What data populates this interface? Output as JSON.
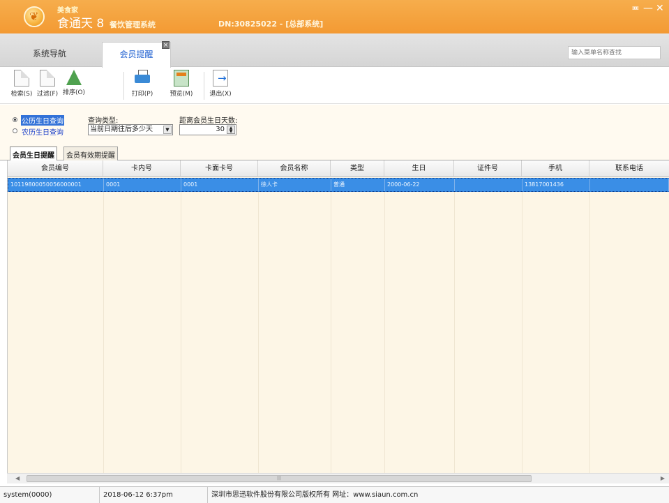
{
  "titlebar": {
    "brand_small": "美食家",
    "brand_main": "食通天 8",
    "brand_sub": "餐饮管理系统",
    "dn": "DN:30825022 - [总部系统]",
    "pin": "≖",
    "minimize": "—",
    "close": "✕"
  },
  "tabs": {
    "nav": "系统导航",
    "active": "会员提醒",
    "close_glyph": "×",
    "search_placeholder": "输入菜单名称查找"
  },
  "toolbar": {
    "items": [
      {
        "label": "检索(S)",
        "icon": "search-doc-icon"
      },
      {
        "label": "过滤(F)",
        "icon": "filter-doc-icon"
      },
      {
        "label": "排序(O)",
        "icon": "sort-icon"
      },
      {
        "label": "打印(P)",
        "icon": "printer-icon"
      },
      {
        "label": "预览(M)",
        "icon": "preview-icon"
      },
      {
        "label": "退出(X)",
        "icon": "exit-icon"
      }
    ]
  },
  "filter": {
    "radio_gregorian": "公历生日查询",
    "radio_lunar": "农历生日查询",
    "query_type_label": "查询类型:",
    "query_type_value": "当前日期往后多少天",
    "days_label": "距离会员生日天数:",
    "days_value": "30"
  },
  "subtabs": {
    "birthday": "会员生日提醒",
    "expiry": "会员有效期提醒"
  },
  "grid": {
    "columns": [
      "会员编号",
      "卡内号",
      "卡面卡号",
      "会员名称",
      "类型",
      "生日",
      "证件号",
      "手机",
      "联系电话"
    ],
    "rows": [
      [
        "10119800050056000001",
        "0001",
        "0001",
        "徐人卡",
        "普通",
        "2000-06-22",
        "",
        "13817001436",
        ""
      ]
    ]
  },
  "statusbar": {
    "user": "system(0000)",
    "datetime": "2018-06-12 6:37pm",
    "copyright": "深圳市思迅软件股份有限公司版权所有 网址：www.siaun.com.cn"
  }
}
